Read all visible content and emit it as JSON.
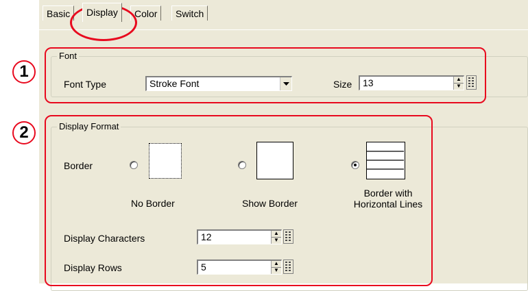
{
  "tabs": [
    {
      "label": "Basic"
    },
    {
      "label": "Display"
    },
    {
      "label": "Color"
    },
    {
      "label": "Switch"
    }
  ],
  "font_group": {
    "title": "Font",
    "font_type_label": "Font Type",
    "font_type_value": "Stroke Font",
    "size_label": "Size",
    "size_value": "13"
  },
  "display_format": {
    "title": "Display Format",
    "border_label": "Border",
    "border_options": [
      {
        "label": "No Border",
        "selected": false
      },
      {
        "label": "Show Border",
        "selected": false
      },
      {
        "label_line1": "Border with",
        "label_line2": "Horizontal Lines",
        "selected": true
      }
    ],
    "display_characters_label": "Display Characters",
    "display_characters_value": "12",
    "display_rows_label": "Display Rows",
    "display_rows_value": "5"
  },
  "callouts": [
    "1",
    "2"
  ],
  "colors": {
    "accent_red": "#e8091e",
    "dialog_bg": "#ece9d8"
  }
}
